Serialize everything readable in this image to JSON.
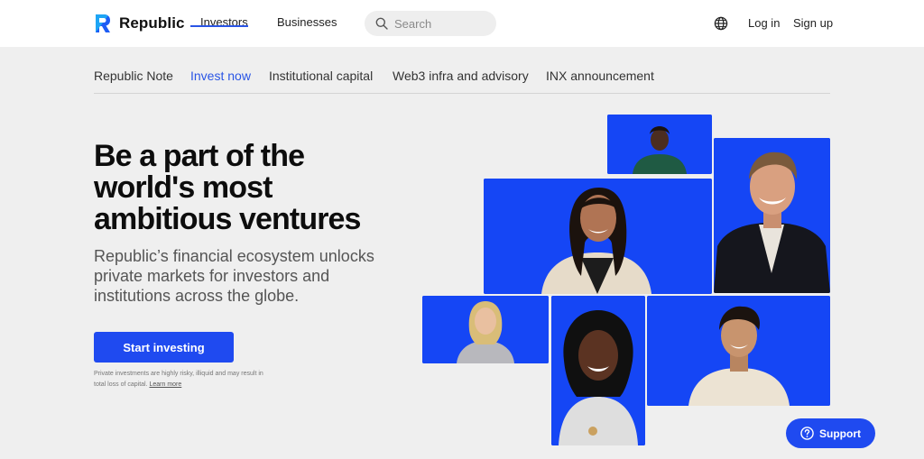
{
  "header": {
    "brand": "Republic",
    "nav": [
      "Investors",
      "Businesses"
    ],
    "search_placeholder": "Search",
    "login": "Log in",
    "signup": "Sign up"
  },
  "tabs": [
    {
      "label": "Republic Note",
      "active": false
    },
    {
      "label": "Invest now",
      "active": true
    },
    {
      "label": "Institutional capital",
      "active": false
    },
    {
      "label": "Web3 infra and advisory",
      "active": false
    },
    {
      "label": "INX announcement",
      "active": false
    }
  ],
  "hero": {
    "headline_lines": [
      "Be a part of the",
      "world's most",
      "ambitious ventures"
    ],
    "subtext": "Republic’s financial ecosystem unlocks private markets for investors and institutions across the globe.",
    "cta": "Start investing",
    "disclaimer": "Private investments are highly risky, illiquid and may result in total loss of capital.",
    "learn_more": "Learn more"
  },
  "support": {
    "label": "Support"
  },
  "colors": {
    "accent": "#1f4af0",
    "photo_bg": "#1546f5",
    "page_bg": "#efefef"
  },
  "icons": [
    "republic-logo-icon",
    "search-icon",
    "globe-icon",
    "help-icon"
  ]
}
